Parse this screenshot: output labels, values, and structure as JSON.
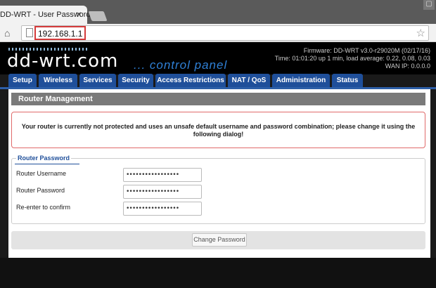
{
  "browser": {
    "tab_title": "DD-WRT - User Password",
    "tab_close": "×",
    "url": "192.168.1.1",
    "icons": [
      "home-icon",
      "page-icon",
      "star-icon",
      "close-icon"
    ]
  },
  "header": {
    "logo": "dd-wrt.com",
    "logo_sub": "... control panel",
    "firmware": "Firmware: DD-WRT v3.0-r29020M (02/17/16)",
    "time": "Time: 01:01:20 up 1 min, load average: 0.22, 0.08, 0.03",
    "wan_ip": "WAN IP: 0.0.0.0"
  },
  "nav": {
    "items": [
      {
        "label": "Setup"
      },
      {
        "label": "Wireless"
      },
      {
        "label": "Services"
      },
      {
        "label": "Security"
      },
      {
        "label": "Access Restrictions"
      },
      {
        "label": "NAT / QoS"
      },
      {
        "label": "Administration"
      },
      {
        "label": "Status"
      }
    ]
  },
  "main": {
    "section_title": "Router Management",
    "warning": "Your router is currently not protected and uses an unsafe default username and password combination; please change it using the following dialog!",
    "fieldset": {
      "legend": "Router Password",
      "rows": [
        {
          "label": "Router Username",
          "value": "•••••••••••••••••"
        },
        {
          "label": "Router Password",
          "value": "•••••••••••••••••"
        },
        {
          "label": "Re-enter to confirm",
          "value": "•••••••••••••••••"
        }
      ]
    },
    "submit_label": "Change Password"
  },
  "colors": {
    "nav_bg": "#1f4f9a",
    "url_highlight": "#d43a3a",
    "logo_accent": "#2f80d6",
    "warning_border": "#e06a6a"
  }
}
